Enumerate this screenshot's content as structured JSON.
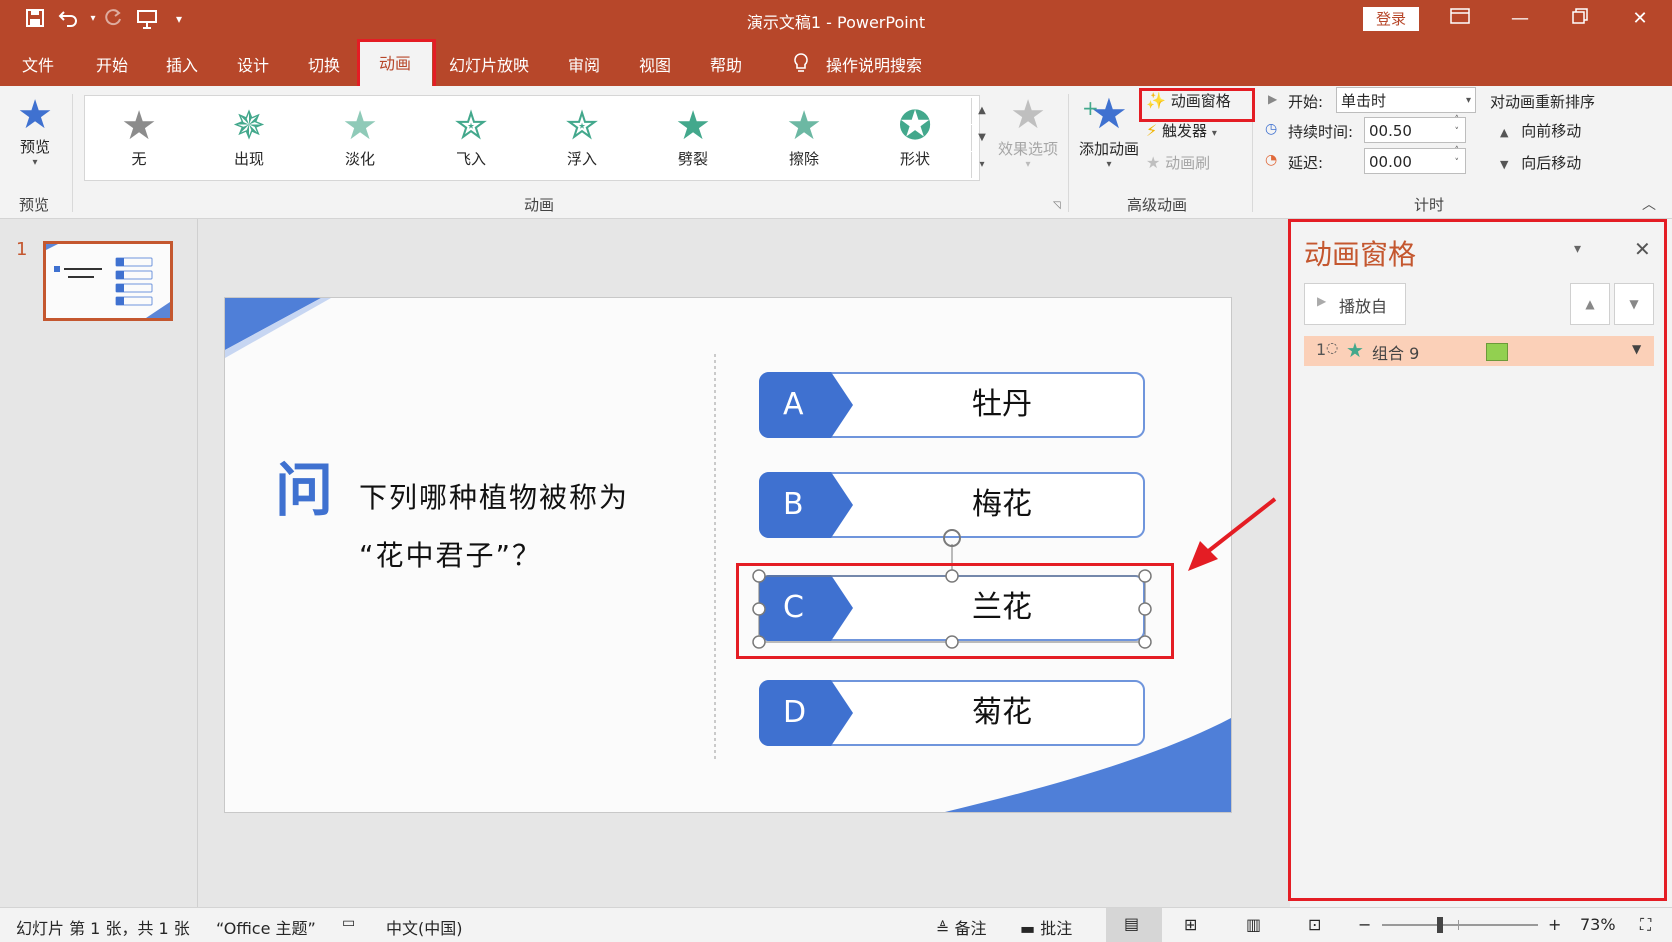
{
  "titlebar": {
    "title": "演示文稿1  -  PowerPoint",
    "login": "登录",
    "icons": [
      "save-icon",
      "undo-icon",
      "redo-icon",
      "present-icon",
      "customize-icon"
    ]
  },
  "tabs": [
    "文件",
    "开始",
    "插入",
    "设计",
    "切换",
    "动画",
    "幻灯片放映",
    "审阅",
    "视图",
    "帮助"
  ],
  "active_tab": "动画",
  "tell_me": "操作说明搜索",
  "ribbon": {
    "preview_label": "预览",
    "preview_group": "预览",
    "animations_group": "动画",
    "animations": [
      {
        "label": "无",
        "color": "#8c8c8c"
      },
      {
        "label": "出现",
        "color": "#43a88c"
      },
      {
        "label": "淡化",
        "color": "#6cb8a3"
      },
      {
        "label": "飞入",
        "color": "#43a88c"
      },
      {
        "label": "浮入",
        "color": "#43a88c"
      },
      {
        "label": "劈裂",
        "color": "#43a88c"
      },
      {
        "label": "擦除",
        "color": "#6cb8a3"
      },
      {
        "label": "形状",
        "color": "#43a88c"
      }
    ],
    "effect_options": "效果选项",
    "add_animation": "添加动画",
    "animation_pane": "动画窗格",
    "trigger": "触发器",
    "animation_painter": "动画刷",
    "advanced_group": "高级动画",
    "start_label": "开始:",
    "start_value": "单击时",
    "duration_label": "持续时间:",
    "duration_value": "00.50",
    "delay_label": "延迟:",
    "delay_value": "00.00",
    "reorder_label": "对动画重新排序",
    "move_earlier": "向前移动",
    "move_later": "向后移动",
    "timing_group": "计时"
  },
  "thumbnail": {
    "number": "1"
  },
  "slide": {
    "question_mark": "问",
    "question_line1": "下列哪种植物被称为",
    "question_line2": "“花中君子”？",
    "options": [
      {
        "letter": "A",
        "text": "牡丹"
      },
      {
        "letter": "B",
        "text": "梅花"
      },
      {
        "letter": "C",
        "text": "兰花"
      },
      {
        "letter": "D",
        "text": "菊花"
      }
    ],
    "accent_color": "#3f71d0"
  },
  "pane": {
    "title": "动画窗格",
    "play_from": "播放自",
    "item_index": "1",
    "item_name": "组合 9",
    "item_bar_color": "#92d050",
    "item_highlight": "#fbd0b8"
  },
  "status": {
    "slide_info": "幻灯片 第 1 张，共 1 张",
    "theme": "“Office 主题”",
    "language": "中文(中国)",
    "notes": "备注",
    "comments": "批注",
    "zoom": "73%",
    "zoom_fraction": 0.37
  }
}
